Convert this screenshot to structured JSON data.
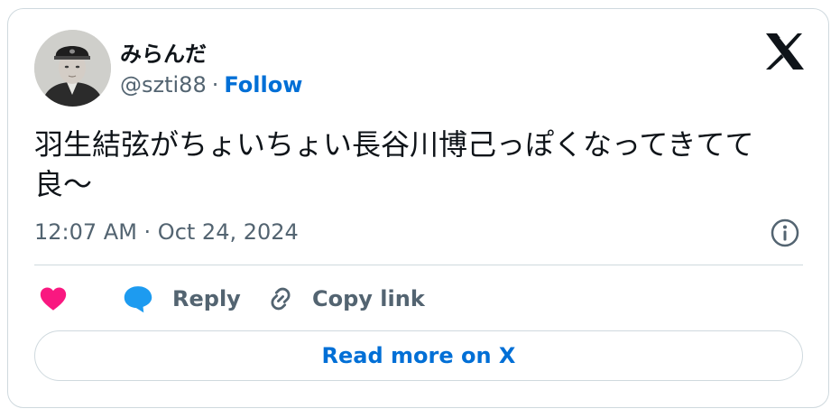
{
  "tweet": {
    "author": {
      "display_name": "みらんだ",
      "handle": "@szti88",
      "separator": "·",
      "follow_label": "Follow"
    },
    "text": "羽生結弦がちょいちょい長谷川博己っぽくなってきてて良〜",
    "timestamp": "12:07 AM · Oct 24, 2024",
    "actions": {
      "like_icon": "heart-icon",
      "reply_label": "Reply",
      "copy_link_label": "Copy link"
    },
    "read_more_label": "Read more on X"
  },
  "colors": {
    "text_primary": "#0f1419",
    "text_secondary": "#536471",
    "link_blue": "#006fd6",
    "like_pink": "#f91880",
    "reply_blue": "#1d9bf0",
    "border": "#cfd9de"
  }
}
